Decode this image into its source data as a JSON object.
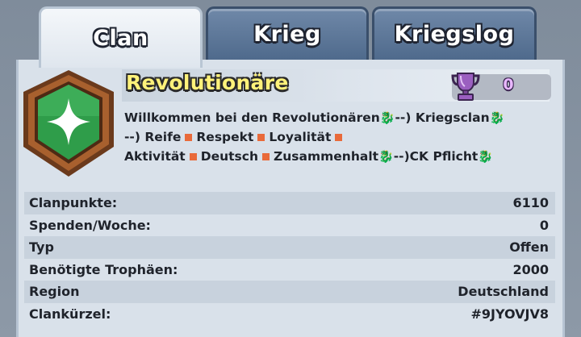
{
  "tabs": [
    {
      "label": "Clan",
      "active": true
    },
    {
      "label": "Krieg",
      "active": false
    },
    {
      "label": "Kriegslog",
      "active": false
    }
  ],
  "clan": {
    "name": "Revolutionäre",
    "trophies": "0",
    "badge_icon": "green-star-shield-icon",
    "description_lines": [
      [
        "Willkommen bei den Revolutionären",
        "dragon",
        "--) Kriegsclan",
        "dragon"
      ],
      [
        "--) Reife",
        "sq",
        "Respekt",
        "sq",
        "Loyalität",
        "sq"
      ],
      [
        "Aktivität",
        "sq",
        "Deutsch",
        "sq",
        "Zusammenhalt",
        "dragon",
        "--)CK Pflicht",
        "dragon"
      ]
    ]
  },
  "stats": [
    {
      "label": "Clanpunkte:",
      "value": "6110"
    },
    {
      "label": "Spenden/Woche:",
      "value": "0"
    },
    {
      "label": "Typ",
      "value": "Offen"
    },
    {
      "label": "Benötigte Trophäen:",
      "value": "2000"
    },
    {
      "label": "Region",
      "value": "Deutschland"
    },
    {
      "label": "Clankürzel:",
      "value": "#9JYOVJV8"
    }
  ],
  "colors": {
    "clan_name": "#fff27a",
    "trophy_purple": "#9b5fc0",
    "badge_green": "#2f9d4a",
    "badge_border": "#8a4a24",
    "separator": "#e96a3a"
  }
}
